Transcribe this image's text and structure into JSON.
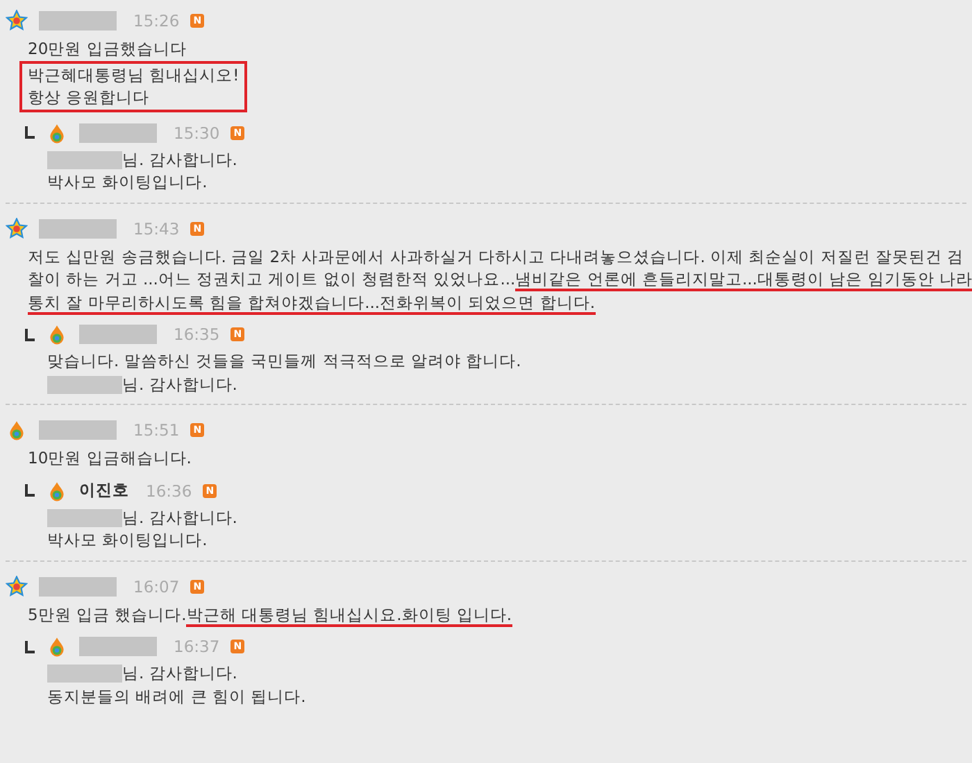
{
  "comments": [
    {
      "avatar": {
        "kind": "star"
      },
      "name_redacted": true,
      "time": "15:26",
      "badge": "N",
      "body": [
        {
          "boxed": false,
          "lines": [
            [
              {
                "kind": "text",
                "text": "20만원 입금했습니다",
                "underlined": false
              }
            ]
          ]
        },
        {
          "boxed": true,
          "lines": [
            [
              {
                "kind": "text",
                "text": "박근혜대통령님 힘내십시오!",
                "underlined": false
              }
            ],
            [
              {
                "kind": "text",
                "text": "항상 응원합니다",
                "underlined": false
              }
            ]
          ]
        }
      ],
      "reply": {
        "avatar": {
          "kind": "drop"
        },
        "name_redacted": true,
        "time": "15:30",
        "badge": "N",
        "lines": [
          [
            {
              "kind": "redacted"
            },
            {
              "kind": "text",
              "text": "님. 감사합니다.",
              "underlined": false
            }
          ],
          [
            {
              "kind": "text",
              "text": "박사모 화이팅입니다.",
              "underlined": false
            }
          ]
        ]
      }
    },
    {
      "avatar": {
        "kind": "star"
      },
      "name_redacted": true,
      "time": "15:43",
      "badge": "N",
      "body": [
        {
          "boxed": false,
          "lines": [
            [
              {
                "kind": "text",
                "text": "저도 십만원 송금했습니다. 금일 2차 사과문에서 사과하실거 다하시고 다내려놓으셨습니다. 이제 최순실이 저질런 잘못된건 검",
                "underlined": false
              }
            ],
            [
              {
                "kind": "text",
                "text": "찰이 하는 거고 ...어느 정권치고 게이트 없이 청렴한적 있었나요...",
                "underlined": false
              },
              {
                "kind": "text",
                "text": "냄비같은 언론에 흔들리지말고...대통령이 남은 임기동안 나라",
                "underlined": true
              }
            ],
            [
              {
                "kind": "text",
                "text": "통치 잘 마무리하시도록 힘을 합쳐야겠습니다...전화위복이 되었으면 합니다.",
                "underlined": true
              }
            ]
          ]
        }
      ],
      "reply": {
        "avatar": {
          "kind": "drop"
        },
        "name_redacted": true,
        "time": "16:35",
        "badge": "N",
        "lines": [
          [
            {
              "kind": "text",
              "text": "맞습니다. 말씀하신 것들을 국민들께 적극적으로 알려야 합니다.",
              "underlined": false
            }
          ],
          [
            {
              "kind": "redacted"
            },
            {
              "kind": "text",
              "text": "님. 감사합니다.",
              "underlined": false
            }
          ]
        ]
      }
    },
    {
      "avatar": {
        "kind": "drop"
      },
      "name_redacted": true,
      "time": "15:51",
      "badge": "N",
      "body": [
        {
          "boxed": false,
          "lines": [
            [
              {
                "kind": "text",
                "text": "10만원 입금해습니다.",
                "underlined": false
              }
            ]
          ]
        }
      ],
      "reply": {
        "avatar": {
          "kind": "drop"
        },
        "name_redacted": false,
        "name": "이진호",
        "time": "16:36",
        "badge": "N",
        "lines": [
          [
            {
              "kind": "redacted"
            },
            {
              "kind": "text",
              "text": "님. 감사합니다.",
              "underlined": false
            }
          ],
          [
            {
              "kind": "text",
              "text": "박사모 화이팅입니다.",
              "underlined": false
            }
          ]
        ]
      }
    },
    {
      "avatar": {
        "kind": "star"
      },
      "name_redacted": true,
      "time": "16:07",
      "badge": "N",
      "body": [
        {
          "boxed": false,
          "lines": [
            [
              {
                "kind": "text",
                "text": "5만원 입금 했습니다.",
                "underlined": false
              },
              {
                "kind": "text",
                "text": "박근해 대통령님 힘내십시요.화이팅 입니다.",
                "underlined": true
              }
            ]
          ]
        }
      ],
      "reply": {
        "avatar": {
          "kind": "drop"
        },
        "name_redacted": true,
        "time": "16:37",
        "badge": "N",
        "lines": [
          [
            {
              "kind": "redacted"
            },
            {
              "kind": "text",
              "text": "님. 감사합니다.",
              "underlined": false
            }
          ],
          [
            {
              "kind": "text",
              "text": "동지분들의 배려에 큰 힘이 됩니다.",
              "underlined": false
            }
          ]
        ]
      }
    }
  ]
}
